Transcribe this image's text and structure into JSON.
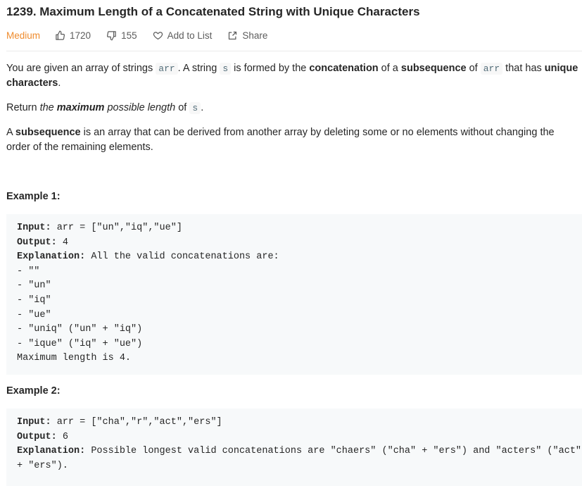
{
  "problem": {
    "title": "1239. Maximum Length of a Concatenated String with Unique Characters",
    "difficulty": "Medium",
    "likes": "1720",
    "dislikes": "155",
    "add_to_list": "Add to List",
    "share": "Share"
  },
  "description": {
    "p1": {
      "t1": "You are given an array of strings ",
      "c1": "arr",
      "t2": ". A string ",
      "c2": "s",
      "t3": " is formed by the ",
      "b1": "concatenation",
      "t4": " of a ",
      "b2": "subsequence",
      "t5": " of ",
      "c3": "arr",
      "t6": " that has ",
      "b3": "unique",
      "b4": "characters",
      "t7": "."
    },
    "p2": {
      "t1": "Return ",
      "i1": "the ",
      "bi": "maximum",
      "i2": " possible length",
      "t2": " of ",
      "c1": "s",
      "t3": "."
    },
    "p3": {
      "b1": "subsequence",
      "t0": "A ",
      "t1": " is an array that can be derived from another array by deleting some or no elements without changing the",
      "t2": "order of the remaining elements."
    }
  },
  "examples": [
    {
      "heading": "Example 1:",
      "input_label": "Input:",
      "input_value": " arr = [\"un\",\"iq\",\"ue\"]",
      "output_label": "Output:",
      "output_value": " 4",
      "explanation_label": "Explanation:",
      "explanation_value": " All the valid concatenations are:",
      "lines": [
        "- \"\"",
        "- \"un\"",
        "- \"iq\"",
        "- \"ue\"",
        "- \"uniq\" (\"un\" + \"iq\")",
        "- \"ique\" (\"iq\" + \"ue\")",
        "Maximum length is 4."
      ]
    },
    {
      "heading": "Example 2:",
      "input_label": "Input:",
      "input_value": " arr = [\"cha\",\"r\",\"act\",\"ers\"]",
      "output_label": "Output:",
      "output_value": " 6",
      "explanation_label": "Explanation:",
      "explanation_value": " Possible longest valid concatenations are \"chaers\" (\"cha\" + \"ers\") and \"acters\" (\"act\"",
      "lines": [
        "+ \"ers\")."
      ]
    }
  ],
  "colors": {
    "difficulty_medium": "#ef8b2c",
    "code_bg": "#f7f9fa",
    "inline_code_fg": "#546e7a"
  },
  "icons": {
    "likes": "thumbs-up-icon",
    "dislikes": "thumbs-down-icon",
    "add_to_list": "heart-icon",
    "share": "share-icon"
  }
}
